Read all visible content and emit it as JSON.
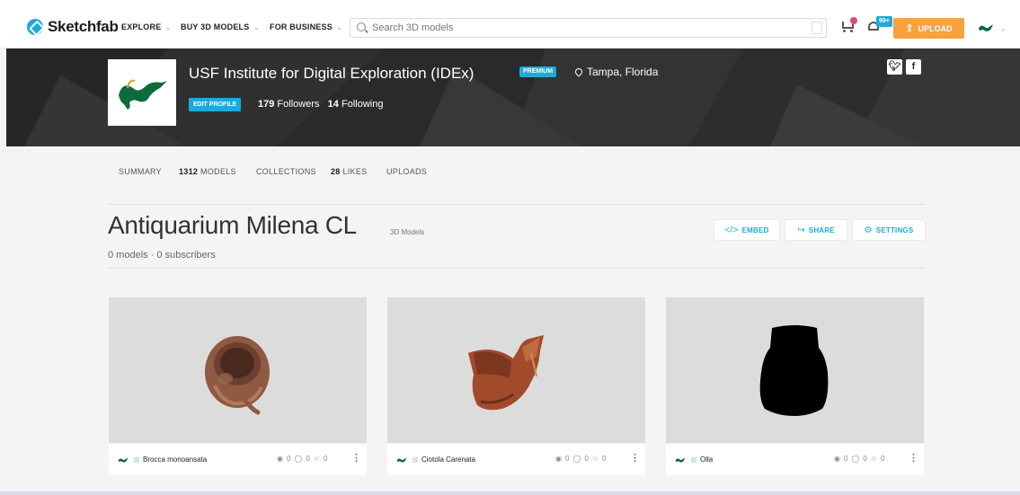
{
  "nav": {
    "brand": "Sketchfab",
    "links": [
      "EXPLORE",
      "BUY 3D MODELS",
      "FOR BUSINESS"
    ],
    "search_placeholder": "Search 3D models",
    "notifications_badge": "99+",
    "upload_label": "UPLOAD"
  },
  "profile": {
    "name": "USF Institute for Digital Exploration (IDEx)",
    "badge": "PREMIUM",
    "location": "Tampa, Florida",
    "edit_label": "EDIT PROFILE",
    "followers_count": "179",
    "followers_label": "Followers",
    "following_count": "14",
    "following_label": "Following"
  },
  "tabs": {
    "summary": "SUMMARY",
    "models_count": "1312",
    "models_label": "MODELS",
    "collections": "COLLECTIONS",
    "likes_count": "28",
    "likes_label": "LIKES",
    "uploads": "UPLOADS"
  },
  "collection": {
    "title": "Antiquarium Milena CL",
    "subtitle": "3D Models",
    "meta": "0 models · 0 subscribers",
    "embed_label": "EMBED",
    "share_label": "SHARE",
    "settings_label": "SETTINGS"
  },
  "models": [
    {
      "title": "Brocca monoansata",
      "views": "0",
      "comments": "0",
      "likes": "0"
    },
    {
      "title": "Ciotola Carenata",
      "views": "0",
      "comments": "0",
      "likes": "0"
    },
    {
      "title": "Olla",
      "views": "0",
      "comments": "0",
      "likes": "0"
    }
  ],
  "colors": {
    "accent": "#1caad9",
    "upload": "#f7a13f",
    "usf_green": "#0b6b3a"
  }
}
